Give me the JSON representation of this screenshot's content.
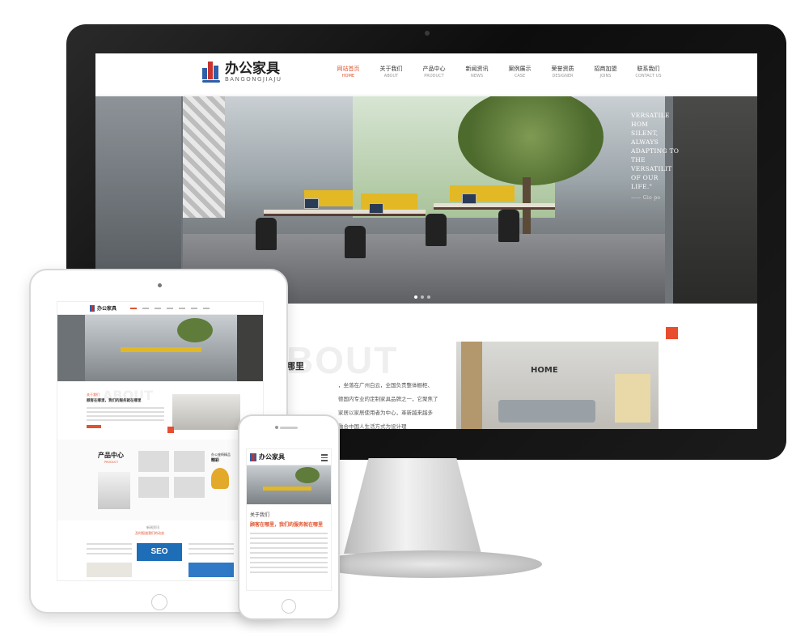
{
  "desktop": {
    "logo": {
      "cn": "办公家具",
      "en": "BANGONGJIAJU"
    },
    "nav": [
      {
        "cn": "网站首页",
        "en": "HOME",
        "active": true
      },
      {
        "cn": "关于我们",
        "en": "ABOUT"
      },
      {
        "cn": "产品中心",
        "en": "PRODUCT"
      },
      {
        "cn": "新闻资讯",
        "en": "NEWS"
      },
      {
        "cn": "案例展示",
        "en": "CASE"
      },
      {
        "cn": "荣誉资质",
        "en": "DESIGNER"
      },
      {
        "cn": "招商加盟",
        "en": "JOINS"
      },
      {
        "cn": "联系我们",
        "en": "CONTACT US"
      }
    ],
    "hero_quote": {
      "lines": [
        "VERSATILE HOM",
        "SILENT, ALWAYS",
        "ADAPTING TO",
        "THE VERSATILIT",
        "OF OUR LIFE.\""
      ],
      "signature": "—— Gio po"
    },
    "about": {
      "ghost": "BOUT",
      "title": "哪里",
      "text": [
        "，坐落在广州白云，全国负责整体橱柜、",
        "德国内专业的定制家具品牌之一，它聚焦了",
        "家居以家居使用者为中心，革新越来越多",
        "融合中国人生活方式为设计理"
      ],
      "photo_label": "HOME"
    }
  },
  "tablet": {
    "logo_cn": "办公家具",
    "about_ghost": "ABOUT",
    "about_kicker": "关于我们",
    "about_title": "顾客在哪里，我们的服务就在哪里",
    "product_title": "产品中心",
    "product_en": "PRODUCT",
    "product_side_a": "办公座椅精品",
    "product_side_b": "精彩",
    "news_kicker": "新闻资讯",
    "news_title": "及时报道我们的动态",
    "seo_text": "SEO"
  },
  "phone": {
    "logo_cn": "办公家具",
    "about_kicker": "关于我们",
    "about_title": "顾客在哪里，我们的服务就在哪里"
  }
}
